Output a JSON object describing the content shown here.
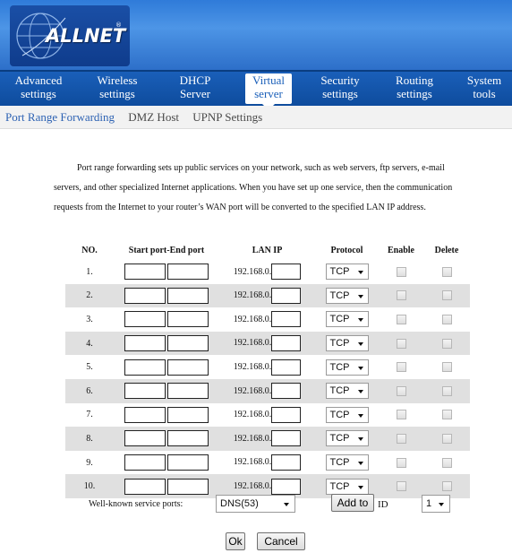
{
  "brand": {
    "name": "ALLNET",
    "registered": "®"
  },
  "nav": {
    "items": [
      {
        "line1": "Advanced",
        "line2": "settings"
      },
      {
        "line1": "Wireless",
        "line2": "settings"
      },
      {
        "line1": "DHCP",
        "line2": "Server"
      },
      {
        "line1": "Virtual",
        "line2": "server"
      },
      {
        "line1": "Security",
        "line2": "settings"
      },
      {
        "line1": "Routing",
        "line2": "settings"
      },
      {
        "line1": "System",
        "line2": "tools"
      }
    ],
    "active_index": 3
  },
  "subnav": {
    "items": [
      "Port Range Forwarding",
      "DMZ Host",
      "UPNP Settings"
    ],
    "current": "Port Range Forwarding"
  },
  "description": "Port range forwarding sets up public services on your network, such as web servers, ftp servers, e-mail servers, and other specialized Internet applications. When you have set up one service, then the communication requests from the Internet to your router’s WAN port will be converted to the specified LAN IP address.",
  "table": {
    "headers": {
      "no": "NO.",
      "ports": "Start port-End port",
      "lan_ip": "LAN IP",
      "protocol": "Protocol",
      "enable": "Enable",
      "delete": "Delete"
    },
    "lan_prefix": "192.168.0.",
    "protocol_value": "TCP",
    "rows": [
      {
        "no": "1."
      },
      {
        "no": "2."
      },
      {
        "no": "3."
      },
      {
        "no": "4."
      },
      {
        "no": "5."
      },
      {
        "no": "6."
      },
      {
        "no": "7."
      },
      {
        "no": "8."
      },
      {
        "no": "9."
      },
      {
        "no": "10."
      }
    ]
  },
  "footer": {
    "well_known_label": "Well-known service ports:",
    "well_known_value": "DNS(53)",
    "add_to_label": "Add to",
    "id_label": "ID",
    "id_value": "1",
    "ok_label": "Ok",
    "cancel_label": "Cancel"
  },
  "colors": {
    "nav_bg": "#1a5fb9",
    "header_bg": "#2f7bd9",
    "row_stripe": "#e0e0e0",
    "active_link": "#2d62b3"
  }
}
